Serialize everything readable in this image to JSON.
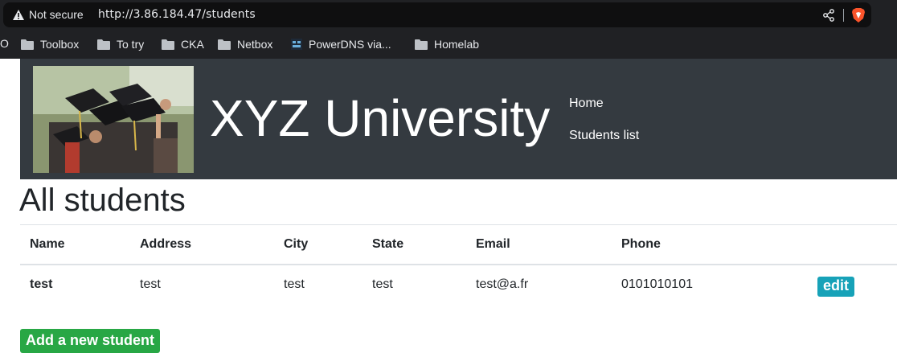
{
  "browser": {
    "security_label": "Not secure",
    "url": "http://3.86.184.47/students",
    "bookmark_clipped": "O",
    "bookmarks": [
      {
        "label": "Toolbox",
        "icon": "folder-icon"
      },
      {
        "label": "To try",
        "icon": "folder-icon"
      },
      {
        "label": "CKA",
        "icon": "folder-icon"
      },
      {
        "label": "Netbox",
        "icon": "folder-icon"
      },
      {
        "label": "PowerDNS via...",
        "icon": "site-favicon"
      },
      {
        "label": "Homelab",
        "icon": "folder-icon"
      }
    ]
  },
  "header": {
    "title": "XYZ University",
    "nav": {
      "home": "Home",
      "students": "Students list"
    },
    "image_alt": "graduation-caps-photo"
  },
  "main": {
    "heading": "All students",
    "table": {
      "columns": [
        "Name",
        "Address",
        "City",
        "State",
        "Email",
        "Phone",
        ""
      ],
      "rows": [
        {
          "name": "test",
          "address": "test",
          "city": "test",
          "state": "test",
          "email": "test@a.fr",
          "phone": "0101010101",
          "action": "edit"
        }
      ]
    },
    "add_button": "Add a new student"
  },
  "colors": {
    "header_bg": "#343a40",
    "edit_button": "#17a2b8",
    "add_button": "#28a745",
    "brave_orange": "#fb542b"
  }
}
